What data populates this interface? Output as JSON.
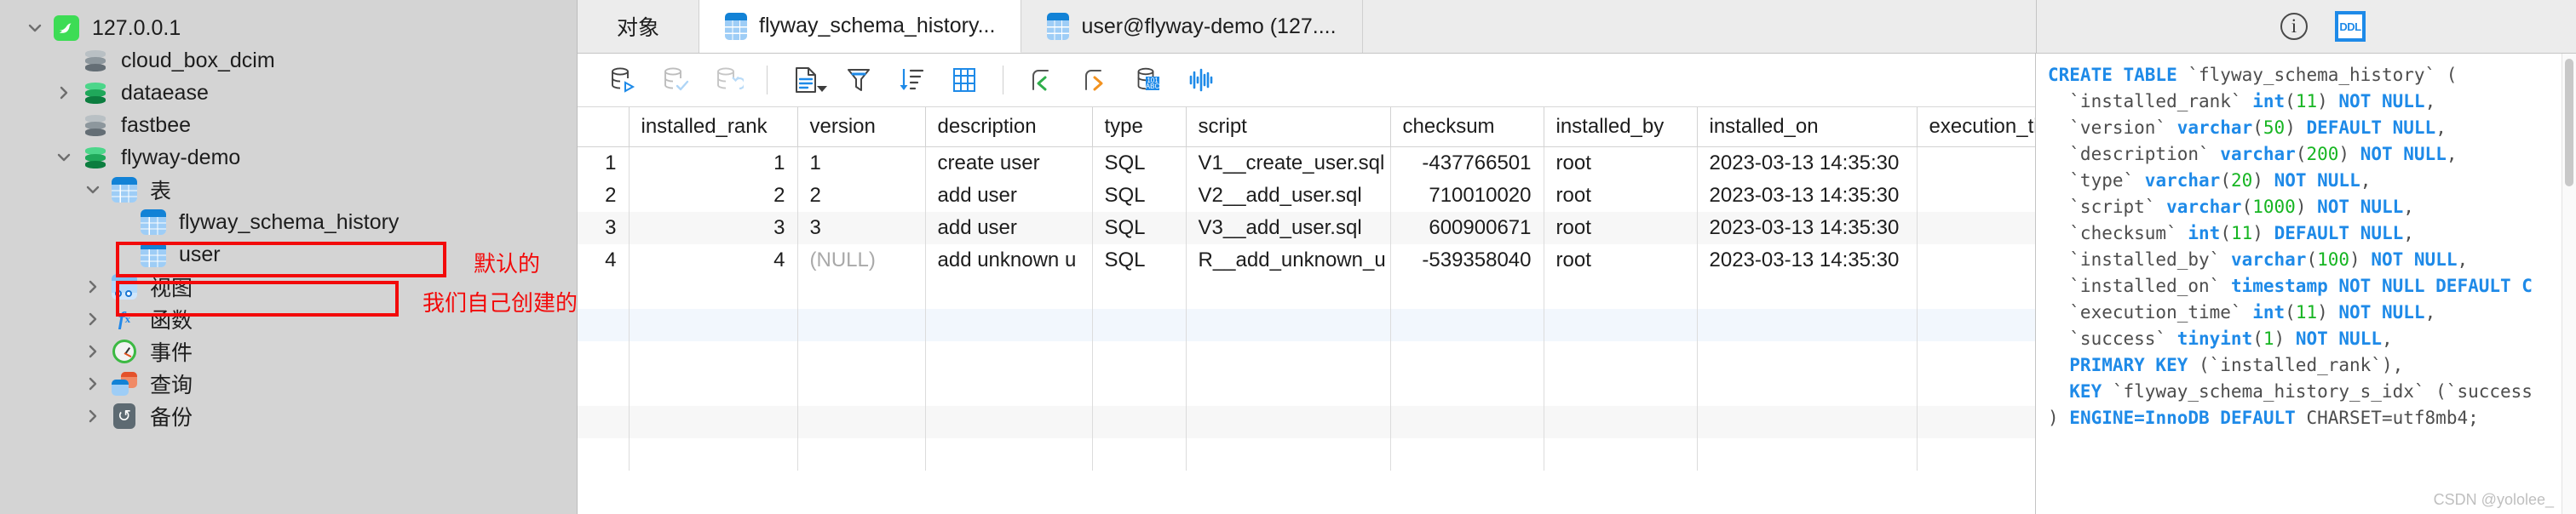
{
  "sidebar": {
    "items": [
      {
        "label": "127.0.0.1",
        "icon": "mysql-icon",
        "depth": 0,
        "twisty": "down"
      },
      {
        "label": "cloud_box_dcim",
        "icon": "database-grey-icon",
        "depth": 1,
        "twisty": "none"
      },
      {
        "label": "dataease",
        "icon": "database-green-icon",
        "depth": 1,
        "twisty": "right"
      },
      {
        "label": "fastbee",
        "icon": "database-grey-icon",
        "depth": 1,
        "twisty": "none"
      },
      {
        "label": "flyway-demo",
        "icon": "database-green-icon",
        "depth": 1,
        "twisty": "down"
      },
      {
        "label": "表",
        "icon": "table-folder-icon",
        "depth": 2,
        "twisty": "down"
      },
      {
        "label": "flyway_schema_history",
        "icon": "table-icon",
        "depth": 3,
        "twisty": "none"
      },
      {
        "label": "user",
        "icon": "table-icon",
        "depth": 3,
        "twisty": "none"
      },
      {
        "label": "视图",
        "icon": "view-icon",
        "depth": 2,
        "twisty": "right"
      },
      {
        "label": "函数",
        "icon": "function-icon",
        "depth": 2,
        "twisty": "right"
      },
      {
        "label": "事件",
        "icon": "event-icon",
        "depth": 2,
        "twisty": "right"
      },
      {
        "label": "查询",
        "icon": "query-icon",
        "depth": 2,
        "twisty": "right"
      },
      {
        "label": "备份",
        "icon": "backup-icon",
        "depth": 2,
        "twisty": "right"
      }
    ],
    "annotations": [
      {
        "text": "默认的",
        "color": "#f20a0a"
      },
      {
        "text": "我们自己创建的",
        "color": "#f20a0a"
      }
    ]
  },
  "tabs": [
    {
      "label": "对象",
      "icon": "none",
      "active": false
    },
    {
      "label": "flyway_schema_history...",
      "icon": "table-icon",
      "active": true
    },
    {
      "label": "user@flyway-demo (127....",
      "icon": "table-icon",
      "active": false
    }
  ],
  "right_header": {
    "info_label": "i",
    "info_icon": "info-icon",
    "ddl_label": "DDL",
    "ddl_icon": "ddl-icon",
    "accent": "#1e8ae8"
  },
  "toolbar": {
    "buttons": [
      {
        "name": "begin-transaction-icon",
        "enabled": true
      },
      {
        "name": "commit-icon",
        "enabled": false
      },
      {
        "name": "rollback-icon",
        "enabled": false
      },
      {
        "name": "separator",
        "enabled": true
      },
      {
        "name": "form-view-icon",
        "enabled": true,
        "caret": true
      },
      {
        "name": "filter-icon",
        "enabled": true
      },
      {
        "name": "sort-icon",
        "enabled": true
      },
      {
        "name": "grid-icon",
        "enabled": true
      },
      {
        "name": "separator",
        "enabled": true
      },
      {
        "name": "undo-icon",
        "enabled": true
      },
      {
        "name": "redo-icon",
        "enabled": true
      },
      {
        "name": "data-types-icon",
        "enabled": true
      },
      {
        "name": "chart-icon",
        "enabled": true
      }
    ]
  },
  "grid": {
    "columns": [
      "installed_rank",
      "version",
      "description",
      "type",
      "script",
      "checksum",
      "installed_by",
      "installed_on",
      "execution_time"
    ],
    "rows": [
      {
        "n": "1",
        "cells": [
          "1",
          "1",
          "create user",
          "SQL",
          "V1__create_user.sql",
          "-437766501",
          "root",
          "2023-03-13 14:35:30",
          ""
        ]
      },
      {
        "n": "2",
        "cells": [
          "2",
          "2",
          "add user",
          "SQL",
          "V2__add_user.sql",
          "710010020",
          "root",
          "2023-03-13 14:35:30",
          ""
        ]
      },
      {
        "n": "3",
        "cells": [
          "3",
          "3",
          "add user",
          "SQL",
          "V3__add_user.sql",
          "600900671",
          "root",
          "2023-03-13 14:35:30",
          ""
        ]
      },
      {
        "n": "4",
        "cells": [
          "4",
          "(NULL)",
          "add unknown u",
          "SQL",
          "R__add_unknown_u",
          "-539358040",
          "root",
          "2023-03-13 14:35:30",
          ""
        ]
      }
    ],
    "null_text": "(NULL)"
  },
  "ddl": {
    "lines": [
      [
        [
          "kw",
          "CREATE TABLE "
        ],
        [
          "id",
          "`flyway_schema_history` ("
        ]
      ],
      [
        [
          "id",
          "  `installed_rank` "
        ],
        [
          "kw",
          "int"
        ],
        [
          "id",
          "("
        ],
        [
          "num",
          "11"
        ],
        [
          "id",
          ") "
        ],
        [
          "kw",
          "NOT NULL"
        ],
        [
          "id",
          ","
        ]
      ],
      [
        [
          "id",
          "  `version` "
        ],
        [
          "kw",
          "varchar"
        ],
        [
          "id",
          "("
        ],
        [
          "num",
          "50"
        ],
        [
          "id",
          ") "
        ],
        [
          "kw",
          "DEFAULT NULL"
        ],
        [
          "id",
          ","
        ]
      ],
      [
        [
          "id",
          "  `description` "
        ],
        [
          "kw",
          "varchar"
        ],
        [
          "id",
          "("
        ],
        [
          "num",
          "200"
        ],
        [
          "id",
          ") "
        ],
        [
          "kw",
          "NOT NULL"
        ],
        [
          "id",
          ","
        ]
      ],
      [
        [
          "id",
          "  `type` "
        ],
        [
          "kw",
          "varchar"
        ],
        [
          "id",
          "("
        ],
        [
          "num",
          "20"
        ],
        [
          "id",
          ") "
        ],
        [
          "kw",
          "NOT NULL"
        ],
        [
          "id",
          ","
        ]
      ],
      [
        [
          "id",
          "  `script` "
        ],
        [
          "kw",
          "varchar"
        ],
        [
          "id",
          "("
        ],
        [
          "num",
          "1000"
        ],
        [
          "id",
          ") "
        ],
        [
          "kw",
          "NOT NULL"
        ],
        [
          "id",
          ","
        ]
      ],
      [
        [
          "id",
          "  `checksum` "
        ],
        [
          "kw",
          "int"
        ],
        [
          "id",
          "("
        ],
        [
          "num",
          "11"
        ],
        [
          "id",
          ") "
        ],
        [
          "kw",
          "DEFAULT NULL"
        ],
        [
          "id",
          ","
        ]
      ],
      [
        [
          "id",
          "  `installed_by` "
        ],
        [
          "kw",
          "varchar"
        ],
        [
          "id",
          "("
        ],
        [
          "num",
          "100"
        ],
        [
          "id",
          ") "
        ],
        [
          "kw",
          "NOT NULL"
        ],
        [
          "id",
          ","
        ]
      ],
      [
        [
          "id",
          "  `installed_on` "
        ],
        [
          "kw",
          "timestamp NOT NULL DEFAULT C"
        ]
      ],
      [
        [
          "id",
          "  `execution_time` "
        ],
        [
          "kw",
          "int"
        ],
        [
          "id",
          "("
        ],
        [
          "num",
          "11"
        ],
        [
          "id",
          ") "
        ],
        [
          "kw",
          "NOT NULL"
        ],
        [
          "id",
          ","
        ]
      ],
      [
        [
          "id",
          "  `success` "
        ],
        [
          "kw",
          "tinyint"
        ],
        [
          "id",
          "("
        ],
        [
          "num",
          "1"
        ],
        [
          "id",
          ") "
        ],
        [
          "kw",
          "NOT NULL"
        ],
        [
          "id",
          ","
        ]
      ],
      [
        [
          "kw",
          "  PRIMARY KEY "
        ],
        [
          "id",
          "(`installed_rank`),"
        ]
      ],
      [
        [
          "kw",
          "  KEY "
        ],
        [
          "id",
          "`flyway_schema_history_s_idx` (`success"
        ]
      ],
      [
        [
          "id",
          ") "
        ],
        [
          "kw",
          "ENGINE=InnoDB DEFAULT "
        ],
        [
          "id",
          "CHARSET=utf8mb4;"
        ]
      ]
    ]
  },
  "watermark": "CSDN @yololee_"
}
